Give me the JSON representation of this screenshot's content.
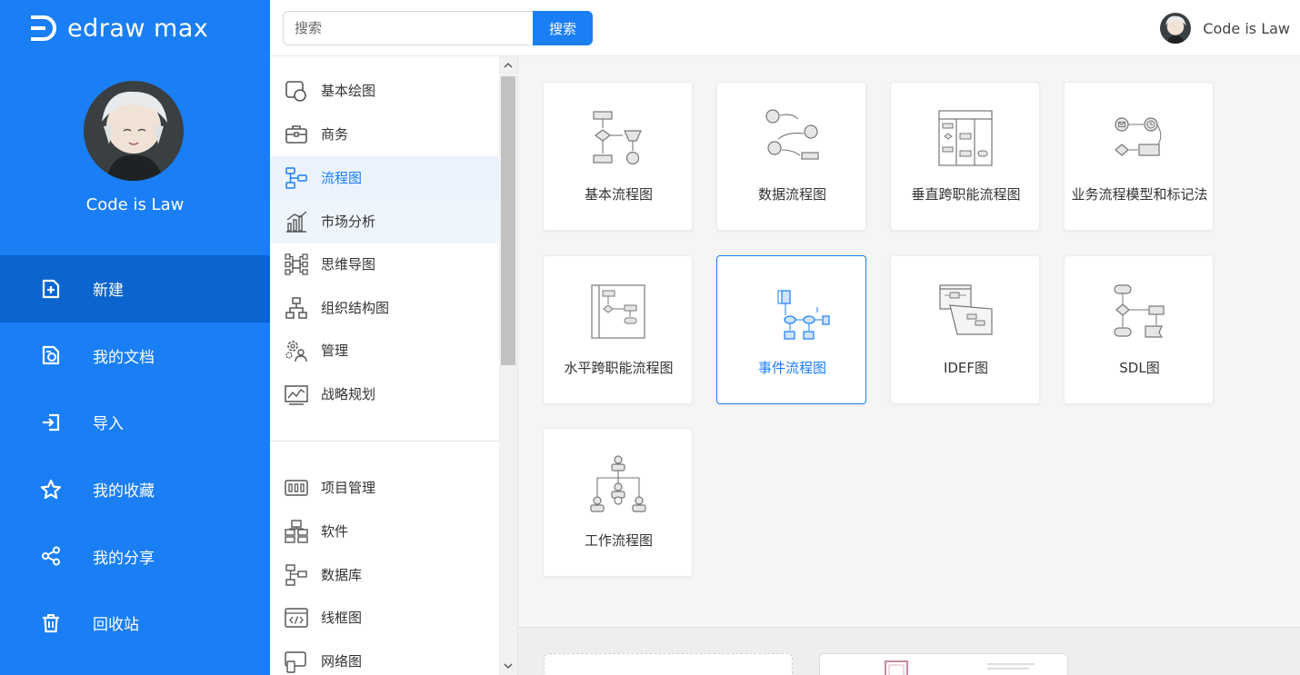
{
  "app": {
    "logo_text": "edraw max"
  },
  "user": {
    "name": "Code is Law"
  },
  "nav": [
    {
      "label": "新建",
      "icon": "new-file-icon",
      "active": true
    },
    {
      "label": "我的文档",
      "icon": "documents-icon"
    },
    {
      "label": "导入",
      "icon": "import-icon"
    },
    {
      "label": "我的收藏",
      "icon": "star-icon"
    },
    {
      "label": "我的分享",
      "icon": "share-icon"
    },
    {
      "label": "回收站",
      "icon": "trash-icon"
    }
  ],
  "search": {
    "placeholder": "搜索",
    "button_label": "搜索"
  },
  "categories": [
    {
      "label": "基本绘图",
      "icon": "basic-shapes-icon"
    },
    {
      "label": "商务",
      "icon": "briefcase-icon"
    },
    {
      "label": "流程图",
      "icon": "flowchart-icon",
      "active": true
    },
    {
      "label": "市场分析",
      "icon": "bar-chart-icon"
    },
    {
      "label": "思维导图",
      "icon": "mindmap-icon"
    },
    {
      "label": "组织结构图",
      "icon": "org-chart-icon"
    },
    {
      "label": "管理",
      "icon": "gears-person-icon"
    },
    {
      "label": "战略规划",
      "icon": "line-chart-icon"
    }
  ],
  "categories_more": [
    {
      "label": "项目管理",
      "icon": "project-icon"
    },
    {
      "label": "软件",
      "icon": "software-icon"
    },
    {
      "label": "数据库",
      "icon": "database-icon"
    },
    {
      "label": "线框图",
      "icon": "wireframe-icon"
    },
    {
      "label": "网络图",
      "icon": "network-icon"
    }
  ],
  "templates": [
    {
      "label": "基本流程图"
    },
    {
      "label": "数据流程图"
    },
    {
      "label": "垂直跨职能流程图"
    },
    {
      "label": "业务流程模型和标记法"
    },
    {
      "label": "水平跨职能流程图"
    },
    {
      "label": "事件流程图",
      "selected": true
    },
    {
      "label": "IDEF图"
    },
    {
      "label": "SDL图"
    },
    {
      "label": "工作流程图"
    }
  ],
  "colors": {
    "brand": "#1a7ef5",
    "brand_dark": "#0c64cf",
    "accent_light": "#eaf3fe"
  }
}
